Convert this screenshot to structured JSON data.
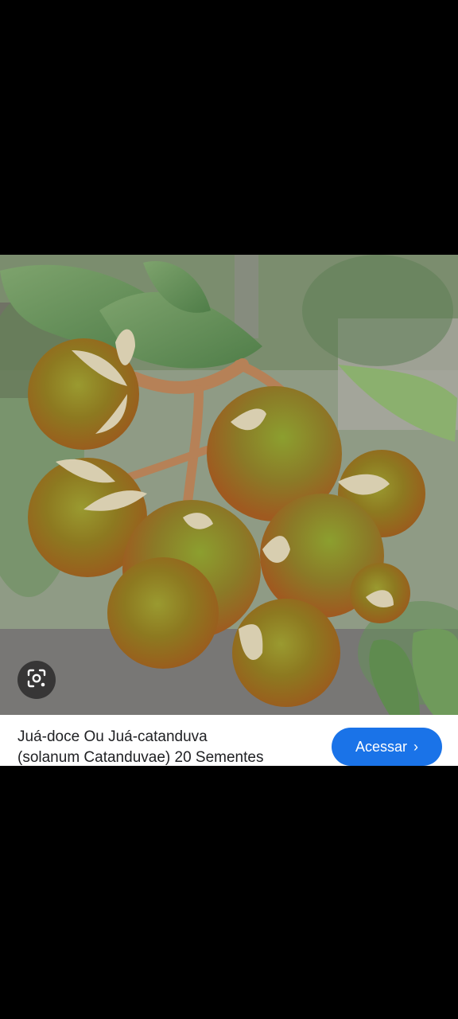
{
  "result": {
    "title_line_1": "Juá-doce Ou Juá-catanduva",
    "title_line_2": "(solanum Catanduvae) 20 Sementes",
    "visit_label": "Acessar",
    "visit_chevron": "›"
  },
  "icons": {
    "lens": "image-search-lens-icon",
    "visit_chevron": "chevron-right-icon"
  },
  "colors": {
    "visit_button": "#1a73e8",
    "caption_bg": "#ffffff",
    "letterbox": "#000000"
  }
}
